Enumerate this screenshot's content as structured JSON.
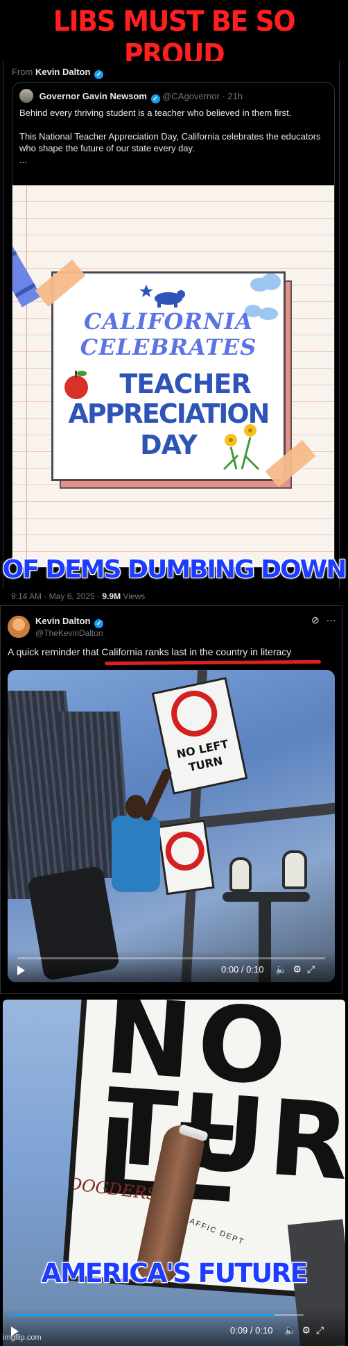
{
  "captions": {
    "top": "LIBS MUST BE SO PROUD",
    "middle": "OF DEMS DUMBING DOWN",
    "bottom": "AMERICA'S FUTURE"
  },
  "quote_tweet": {
    "from_label": "From",
    "from_name": "Kevin Dalton",
    "author_name": "Governor Gavin Newsom",
    "author_handle": "@CAgovernor",
    "age": "· 21h",
    "text_p1": "Behind every thriving student is a teacher who believed in them first.",
    "text_p2": "This National Teacher Appreciation Day, California celebrates the educators who shape the future of our state every day.",
    "text_p3": "...",
    "image_text": {
      "line1": "CALIFORNIA",
      "line2": "CELEBRATES",
      "line3": "TEACHER",
      "line4": "APPRECIATION",
      "line5": "DAY"
    },
    "timestamp": "9:14 AM · May 6, 2025 ·",
    "views_count": "9.9M",
    "views_label": "Views"
  },
  "tweet": {
    "author_name": "Kevin Dalton",
    "author_handle": "@TheKevinDalton",
    "text": "A quick reminder that California ranks last in the country in literacy",
    "video": {
      "sign_text_1": "NO LEFT",
      "sign_text_2": "TURN",
      "time": "0:00 / 0:10",
      "progress": 0.0
    }
  },
  "closeup_video": {
    "sign_text_1": "NO LE",
    "sign_text_2": "TURN",
    "graffiti": "DOGDERS",
    "dept_text": "TRAFFIC DEPT",
    "time": "0:09 / 0:10",
    "progress": 0.9
  },
  "watermark": "imgflip.com",
  "colors": {
    "caption_top": "#ff1f1f",
    "caption_blue": "#1d3cff",
    "verified": "#1d9bf0",
    "underline": "#e11f1f"
  },
  "icons": [
    "verified-icon",
    "grok-icon",
    "more-icon",
    "play-icon",
    "volume-icon",
    "settings-icon",
    "fullscreen-icon"
  ]
}
